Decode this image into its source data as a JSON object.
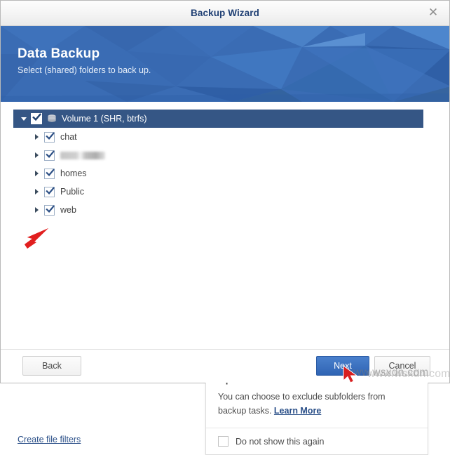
{
  "window": {
    "title": "Backup Wizard",
    "close_icon": "close-icon"
  },
  "banner": {
    "title": "Data Backup",
    "subtitle": "Select (shared) folders to back up."
  },
  "tree": {
    "root": {
      "label": "Volume 1 (SHR, btrfs)",
      "checked": true,
      "expanded": true,
      "icon": "volume-icon"
    },
    "children": [
      {
        "label": "chat",
        "checked": true,
        "redacted": false
      },
      {
        "label": "",
        "checked": true,
        "redacted": true
      },
      {
        "label": "homes",
        "checked": true,
        "redacted": false
      },
      {
        "label": "Public",
        "checked": true,
        "redacted": false
      },
      {
        "label": "web",
        "checked": true,
        "redacted": false
      }
    ]
  },
  "tip": {
    "title": "Tip",
    "text": "You can choose to exclude subfolders from backup tasks.",
    "link_label": "Learn More",
    "dont_show_label": "Do not show this again",
    "dont_show_checked": false,
    "close_icon": "close-icon"
  },
  "links": {
    "create_file_filters": "Create file filters"
  },
  "footer": {
    "back_label": "Back",
    "next_label": "Next",
    "cancel_label": "Cancel"
  },
  "annotations": {
    "tree_arrow": "red-arrow-annotation",
    "cursor_arrow": "mouse-cursor-annotation",
    "watermark_text": "www.wsxdn.com",
    "watermark_text_2": "www.wsxdn.com"
  },
  "colors": {
    "banner_blue": "#3a6cb4",
    "selected_row": "#355685",
    "primary_button": "#3b72c4",
    "link_blue": "#2a4f88",
    "annotation_red": "#e11f1f"
  }
}
